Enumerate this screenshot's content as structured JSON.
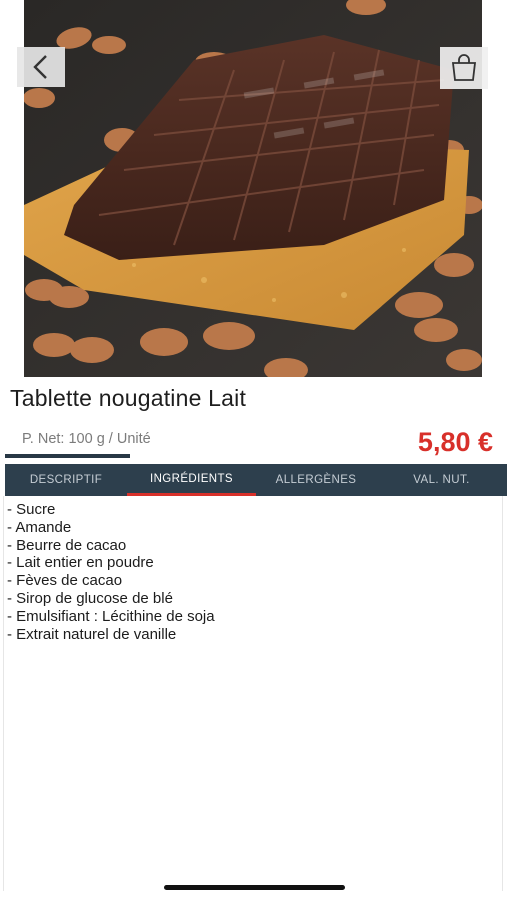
{
  "product": {
    "title": "Tablette nougatine Lait",
    "net_weight": "P. Net: 100 g / Unité",
    "price": "5,80 €"
  },
  "tabs": [
    {
      "label": "DESCRIPTIF",
      "active": false
    },
    {
      "label": "INGRÉDIENTS",
      "active": true
    },
    {
      "label": "ALLERGÈNES",
      "active": false
    },
    {
      "label": "VAL. NUT.",
      "active": false
    }
  ],
  "ingredients": [
    "- Sucre",
    "- Amande",
    "- Beurre de cacao",
    "- Lait entier en poudre",
    "- Fèves de cacao",
    "- Sirop de glucose de blé",
    "- Emulsifiant : Lécithine de soja",
    "- Extrait naturel de vanille"
  ],
  "icons": {
    "back": "chevron-left-icon",
    "cart": "shopping-bag-icon"
  },
  "colors": {
    "price": "#d8302a",
    "tab_bar": "#2d3f4d",
    "active_tab_indicator": "#d8302a"
  }
}
